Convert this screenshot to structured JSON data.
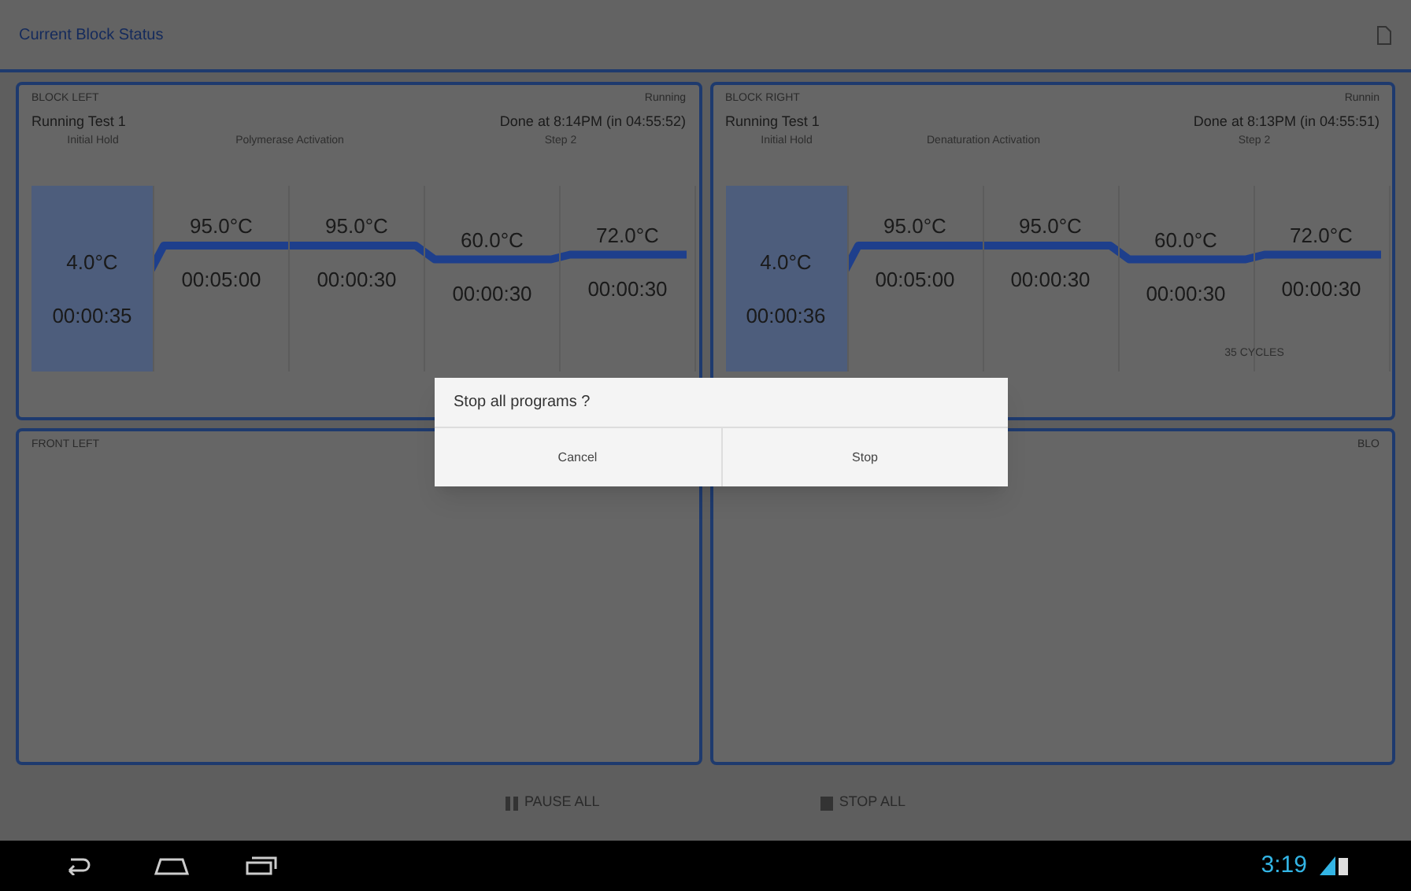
{
  "app_bar": {
    "title": "Current Block Status"
  },
  "blocks": [
    {
      "name": "BLOCK LEFT",
      "status": "Running",
      "program": "Running Test 1",
      "eta": "Done at 8:14PM (in 04:55:52)",
      "stages": [
        {
          "label": "Initial Hold",
          "steps": [
            {
              "temp": "4.0°C",
              "time": "00:00:35",
              "selected": true
            }
          ]
        },
        {
          "label": "Polymerase Activation",
          "steps": [
            {
              "temp": "95.0°C",
              "time": "00:05:00",
              "selected": false
            },
            {
              "temp": "95.0°C",
              "time": "00:00:30",
              "selected": false
            }
          ]
        },
        {
          "label": "Step 2",
          "steps": [
            {
              "temp": "60.0°C",
              "time": "00:00:30",
              "selected": false
            },
            {
              "temp": "72.0°C",
              "time": "00:00:30",
              "selected": false
            }
          ]
        }
      ]
    },
    {
      "name": "BLOCK RIGHT",
      "status": "Runnin",
      "program": "Running Test 1",
      "eta": "Done at 8:13PM (in 04:55:51)",
      "stages": [
        {
          "label": "Initial Hold",
          "steps": [
            {
              "temp": "4.0°C",
              "time": "00:00:36",
              "selected": true
            }
          ]
        },
        {
          "label": "Denaturation Activation",
          "steps": [
            {
              "temp": "95.0°C",
              "time": "00:05:00",
              "selected": false
            },
            {
              "temp": "95.0°C",
              "time": "00:00:30",
              "selected": false
            }
          ]
        },
        {
          "label": "Step 2",
          "cycles": "35 CYCLES",
          "steps": [
            {
              "temp": "60.0°C",
              "time": "00:00:30",
              "selected": false
            },
            {
              "temp": "72.0°C",
              "time": "00:00:30",
              "selected": false
            }
          ]
        }
      ]
    },
    {
      "name": "FRONT LEFT"
    },
    {
      "status": "BLO"
    }
  ],
  "actions": [
    {
      "kind": "pause",
      "label": "PAUSE ALL"
    },
    {
      "kind": "stop",
      "label": "STOP ALL"
    }
  ],
  "dialog": {
    "message": "Stop all programs ?",
    "buttons": [
      "Cancel",
      "Stop"
    ]
  },
  "status_bar": {
    "time": "3:19"
  }
}
